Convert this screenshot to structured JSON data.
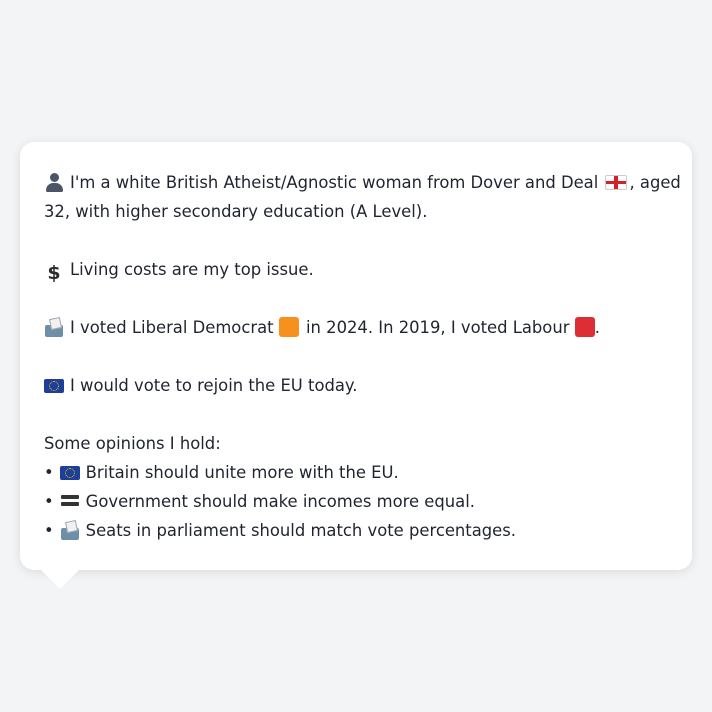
{
  "intro": {
    "part1": "I'm a white British Atheist/Agnostic woman from Dover and Deal",
    "part2": ", aged",
    "line2": "32, with higher secondary education (A Level)."
  },
  "top_issue": "Living costs are my top issue.",
  "vote": {
    "part1": "I voted Liberal Democrat",
    "part2": "in 2024. In 2019, I voted Labour",
    "part3": "."
  },
  "eu_stance": "I would vote to rejoin the EU today.",
  "opinions": {
    "heading": "Some opinions I hold:",
    "bullet": "•",
    "items": [
      "Britain should unite more with the EU.",
      "Government should make incomes more equal.",
      "Seats in parliament should match vote percentages."
    ]
  },
  "icons": {
    "person": "person-icon",
    "england_flag": "england-flag-icon",
    "dollar": "dollar-icon",
    "ballot_box": "ballot-box-icon",
    "orange_square": "orange-square-icon",
    "red_square": "red-square-icon",
    "eu_flag": "eu-flag-icon",
    "equals": "equals-icon"
  },
  "colors": {
    "background": "#f3f4f6",
    "card": "#ffffff",
    "text": "#1f2430",
    "lib_dem_orange": "#f7911d",
    "labour_red": "#dd2e35",
    "eu_blue": "#1e3f99"
  }
}
